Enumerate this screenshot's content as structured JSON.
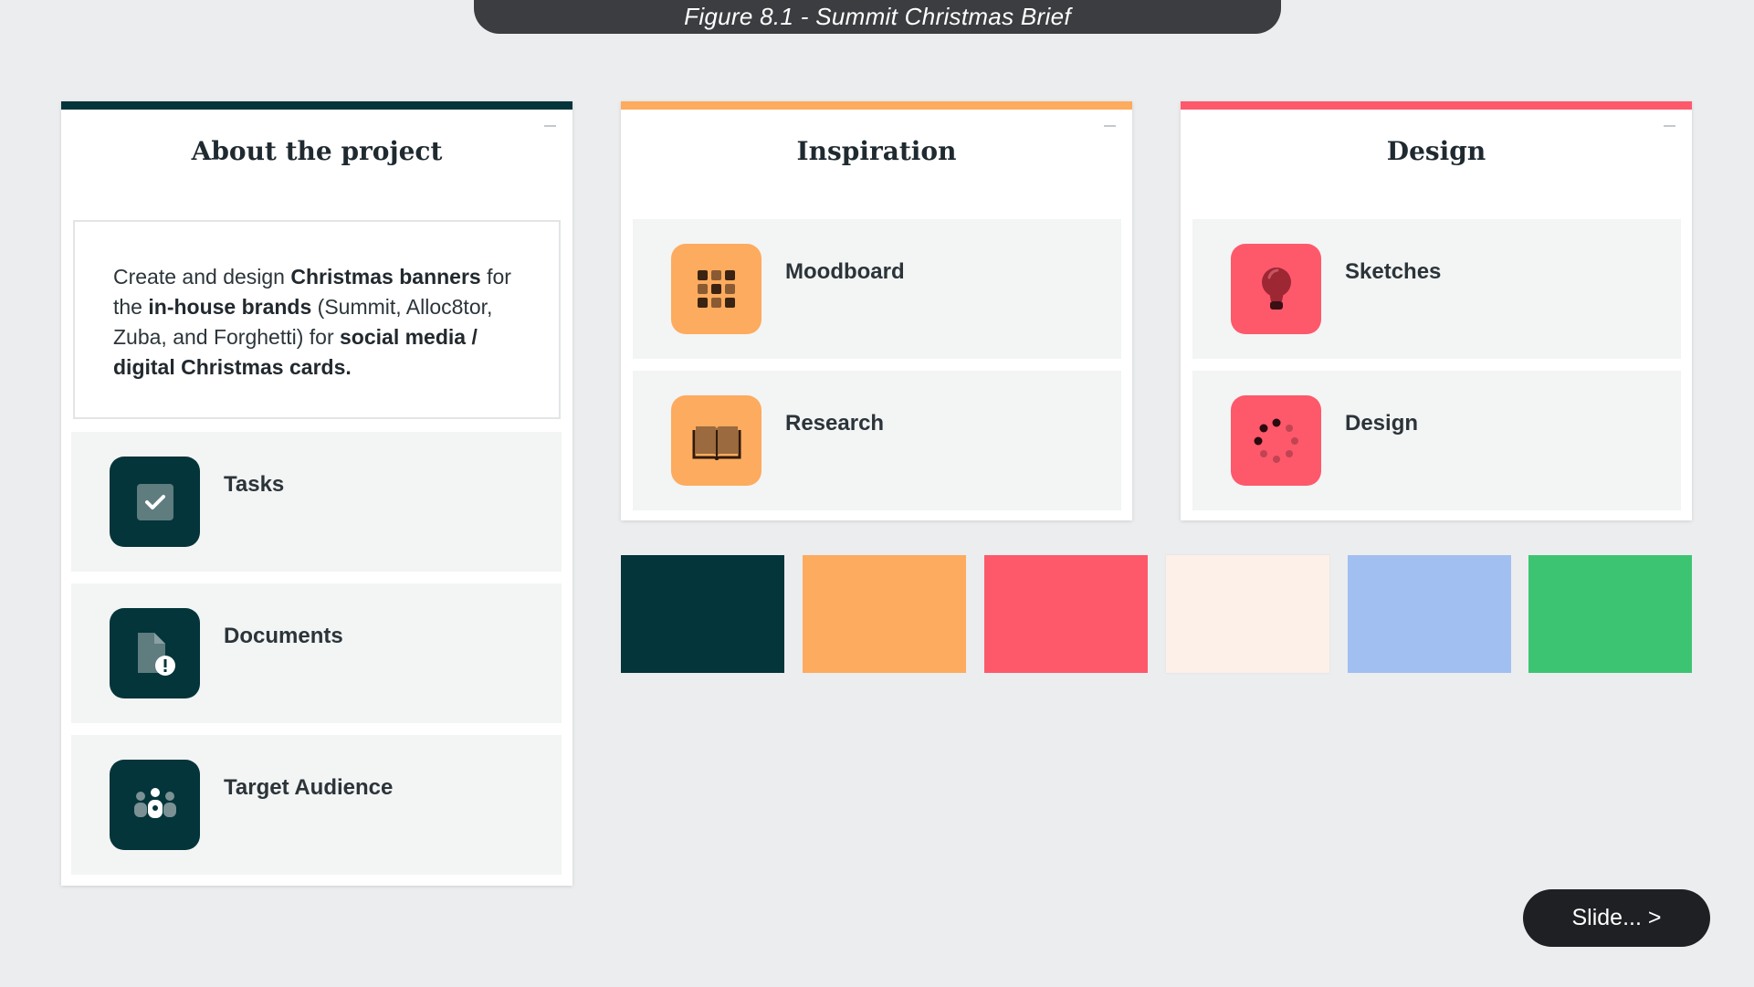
{
  "figure_caption": "Figure 8.1 - Summit Christmas Brief",
  "colors": {
    "teal_dark": "#03353a",
    "orange": "#fdab5e",
    "coral": "#fd596b",
    "cream": "#fcf0e8",
    "periwinkle": "#a2bff1",
    "green": "#3dc473",
    "card_bg": "#f3f4f4",
    "page_bg": "#ecedef"
  },
  "about": {
    "title": "About the project",
    "description": {
      "t1": "Create and design ",
      "b1": "Christmas banners",
      "t2": " for the ",
      "b2": "in-house brands",
      "t3": " (Summit, Alloc8tor, Zuba, and Forghetti) for ",
      "b3": "social media / digital Christmas cards."
    },
    "items": [
      {
        "label": "Tasks",
        "icon": "checkbox-icon"
      },
      {
        "label": "Documents",
        "icon": "document-alert-icon"
      },
      {
        "label": "Target Audience",
        "icon": "people-icon"
      }
    ]
  },
  "inspiration": {
    "title": "Inspiration",
    "items": [
      {
        "label": "Moodboard",
        "icon": "grid-icon"
      },
      {
        "label": "Research",
        "icon": "book-icon"
      }
    ]
  },
  "design": {
    "title": "Design",
    "items": [
      {
        "label": "Sketches",
        "icon": "lightbulb-icon"
      },
      {
        "label": "Design",
        "icon": "loading-dots-icon"
      }
    ]
  },
  "palette": [
    "#03353a",
    "#fdab5e",
    "#fd596b",
    "#fcf0e8",
    "#a2bff1",
    "#3dc473"
  ],
  "slide_button": {
    "label": "Slide... >"
  }
}
